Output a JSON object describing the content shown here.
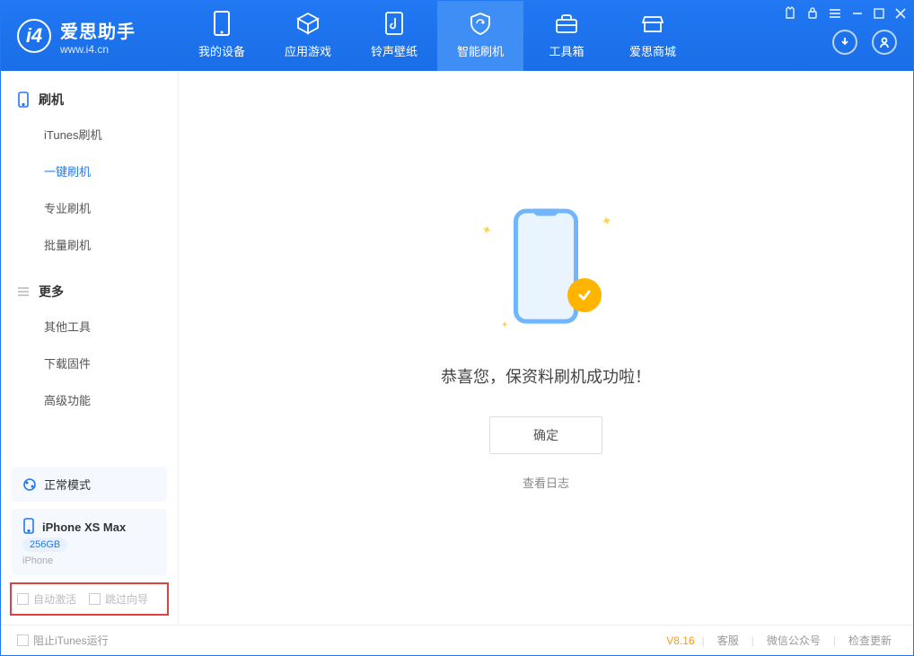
{
  "app": {
    "title": "爱思助手",
    "subtitle": "www.i4.cn"
  },
  "nav": {
    "items": [
      {
        "label": "我的设备"
      },
      {
        "label": "应用游戏"
      },
      {
        "label": "铃声壁纸"
      },
      {
        "label": "智能刷机"
      },
      {
        "label": "工具箱"
      },
      {
        "label": "爱思商城"
      }
    ],
    "active_index": 3
  },
  "sidebar": {
    "section1": {
      "title": "刷机",
      "items": [
        "iTunes刷机",
        "一键刷机",
        "专业刷机",
        "批量刷机"
      ],
      "selected_index": 1
    },
    "section2": {
      "title": "更多",
      "items": [
        "其他工具",
        "下载固件",
        "高级功能"
      ]
    },
    "mode": "正常模式",
    "device": {
      "name": "iPhone XS Max",
      "capacity": "256GB",
      "type": "iPhone"
    },
    "checkboxes": {
      "auto_activate": "自动激活",
      "skip_wizard": "跳过向导"
    }
  },
  "main": {
    "success_message": "恭喜您，保资料刷机成功啦！",
    "ok_button": "确定",
    "view_log": "查看日志"
  },
  "footer": {
    "prevent_itunes": "阻止iTunes运行",
    "version": "V8.16",
    "links": [
      "客服",
      "微信公众号",
      "检查更新"
    ]
  }
}
